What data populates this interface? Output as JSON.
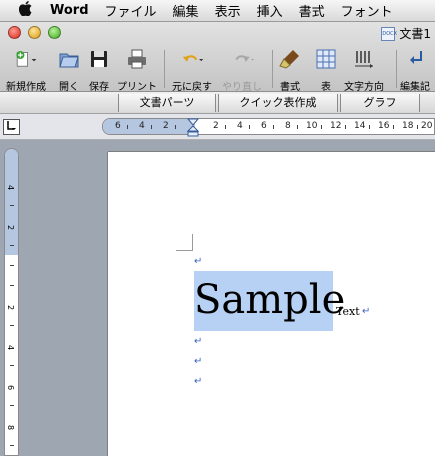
{
  "menubar": {
    "apple": "",
    "app_name": "Word",
    "items": [
      "ファイル",
      "編集",
      "表示",
      "挿入",
      "書式",
      "フォント"
    ]
  },
  "window": {
    "title": "文書1",
    "doc_icon_label": "DOCX"
  },
  "toolbar": {
    "items": [
      {
        "label": "新規作成",
        "icon": "new-document-icon",
        "enabled": true
      },
      {
        "label": "開く",
        "icon": "open-folder-icon",
        "enabled": true
      },
      {
        "label": "保存",
        "icon": "save-disk-icon",
        "enabled": true
      },
      {
        "label": "プリント",
        "icon": "printer-icon",
        "enabled": true
      },
      {
        "label": "元に戻す",
        "icon": "undo-icon",
        "enabled": true
      },
      {
        "label": "やり直し",
        "icon": "redo-icon",
        "enabled": false
      },
      {
        "label": "書式",
        "icon": "format-brush-icon",
        "enabled": true
      },
      {
        "label": "表",
        "icon": "table-icon",
        "enabled": true
      },
      {
        "label": "文字方向",
        "icon": "text-direction-icon",
        "enabled": true
      },
      {
        "label": "編集記",
        "icon": "edit-marks-icon",
        "enabled": true
      }
    ]
  },
  "gallery_tabs": [
    "文書パーツ",
    "クイック表作成",
    "グラフ"
  ],
  "ruler": {
    "horizontal_labels": [
      "6",
      "4",
      "2",
      "2",
      "4",
      "6",
      "8",
      "10",
      "12",
      "14",
      "16",
      "18",
      "20"
    ],
    "vertical_labels": [
      "4",
      "2",
      "2",
      "4",
      "6",
      "8"
    ]
  },
  "document": {
    "paragraph_mark": "↵",
    "sample_word": "Sample",
    "trailing_word": "Text"
  },
  "colors": {
    "highlight": "#b7d1f4",
    "paragraph_mark": "#3b64c0",
    "ruler_margin": "#b5c6e0",
    "workspace": "#9ea6b2"
  }
}
